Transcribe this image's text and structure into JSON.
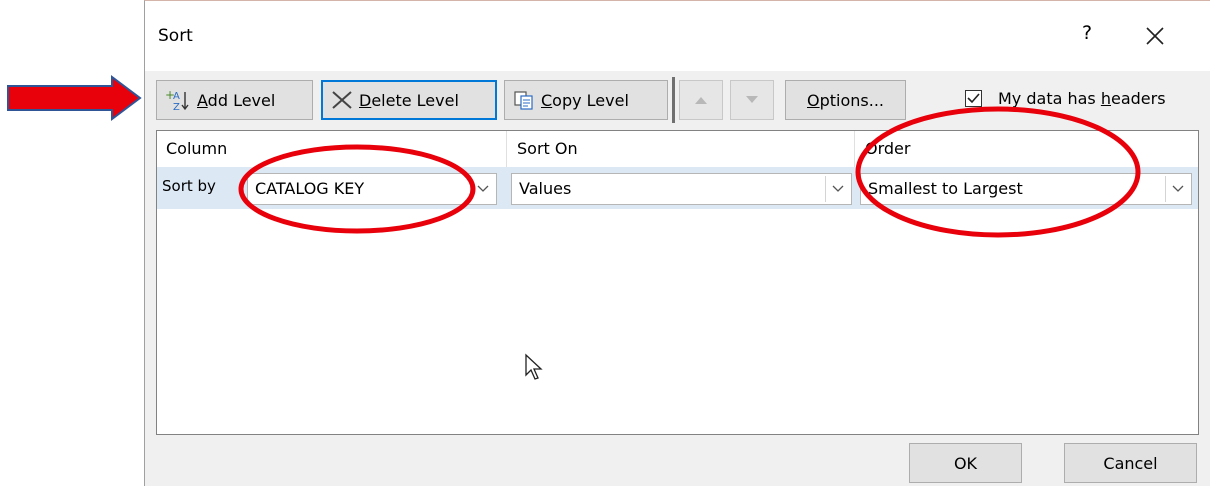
{
  "dialog": {
    "title": "Sort",
    "help_label": "?",
    "close_icon": "close-icon"
  },
  "toolbar": {
    "add_level": {
      "icon": "add-level-icon",
      "prefix": "",
      "mnemonic": "A",
      "rest": "dd Level"
    },
    "delete_level": {
      "icon": "delete-x-icon",
      "mnemonic": "D",
      "rest": "elete Level"
    },
    "copy_level": {
      "icon": "copy-icon",
      "mnemonic": "C",
      "rest": "opy Level"
    },
    "move_up_icon": "arrow-up-icon",
    "move_down_icon": "arrow-down-icon",
    "options": {
      "mnemonic": "O",
      "rest": "ptions..."
    },
    "headers_checkbox": {
      "label_pre": "My data has ",
      "mnemonic": "h",
      "label_post": "eaders",
      "checked": true
    }
  },
  "grid": {
    "columns": [
      "Column",
      "Sort On",
      "Order"
    ],
    "rows": [
      {
        "label": "Sort by",
        "column": "CATALOG KEY",
        "sort_on": "Values",
        "order": "Smallest to Largest"
      }
    ]
  },
  "footer": {
    "ok": "OK",
    "cancel": "Cancel"
  },
  "annotations": {
    "arrow_color": "#e8000b",
    "circle_color": "#e8000b"
  }
}
